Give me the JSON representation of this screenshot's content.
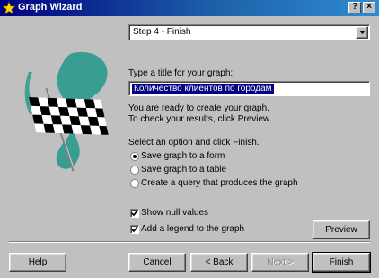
{
  "window": {
    "title": "Graph Wizard",
    "close_glyph": "×",
    "help_glyph": "?"
  },
  "step_select": {
    "value": "Step 4 - Finish"
  },
  "title_prompt": "Type a title for your graph:",
  "title_value": "Количество клиентов по городам",
  "ready_text_1": "You are ready to create your graph.",
  "ready_text_2": "To check your results, click Preview.",
  "option_prompt": "Select an option and click Finish.",
  "options": [
    {
      "label": "Save graph to a form",
      "selected": true
    },
    {
      "label": "Save graph to a table",
      "selected": false
    },
    {
      "label": "Create a query that produces the graph",
      "selected": false
    }
  ],
  "checkboxes": [
    {
      "label": "Show null values",
      "checked": true
    },
    {
      "label": "Add a legend to the graph",
      "checked": true
    }
  ],
  "buttons": {
    "preview": "Preview",
    "help": "Help",
    "cancel": "Cancel",
    "back": "< Back",
    "next": "Next >",
    "finish": "Finish"
  },
  "icons": {
    "window": "wizard-wand-icon",
    "illustration": "checkered-flag-icon",
    "dropdown": "chevron-down-icon"
  }
}
